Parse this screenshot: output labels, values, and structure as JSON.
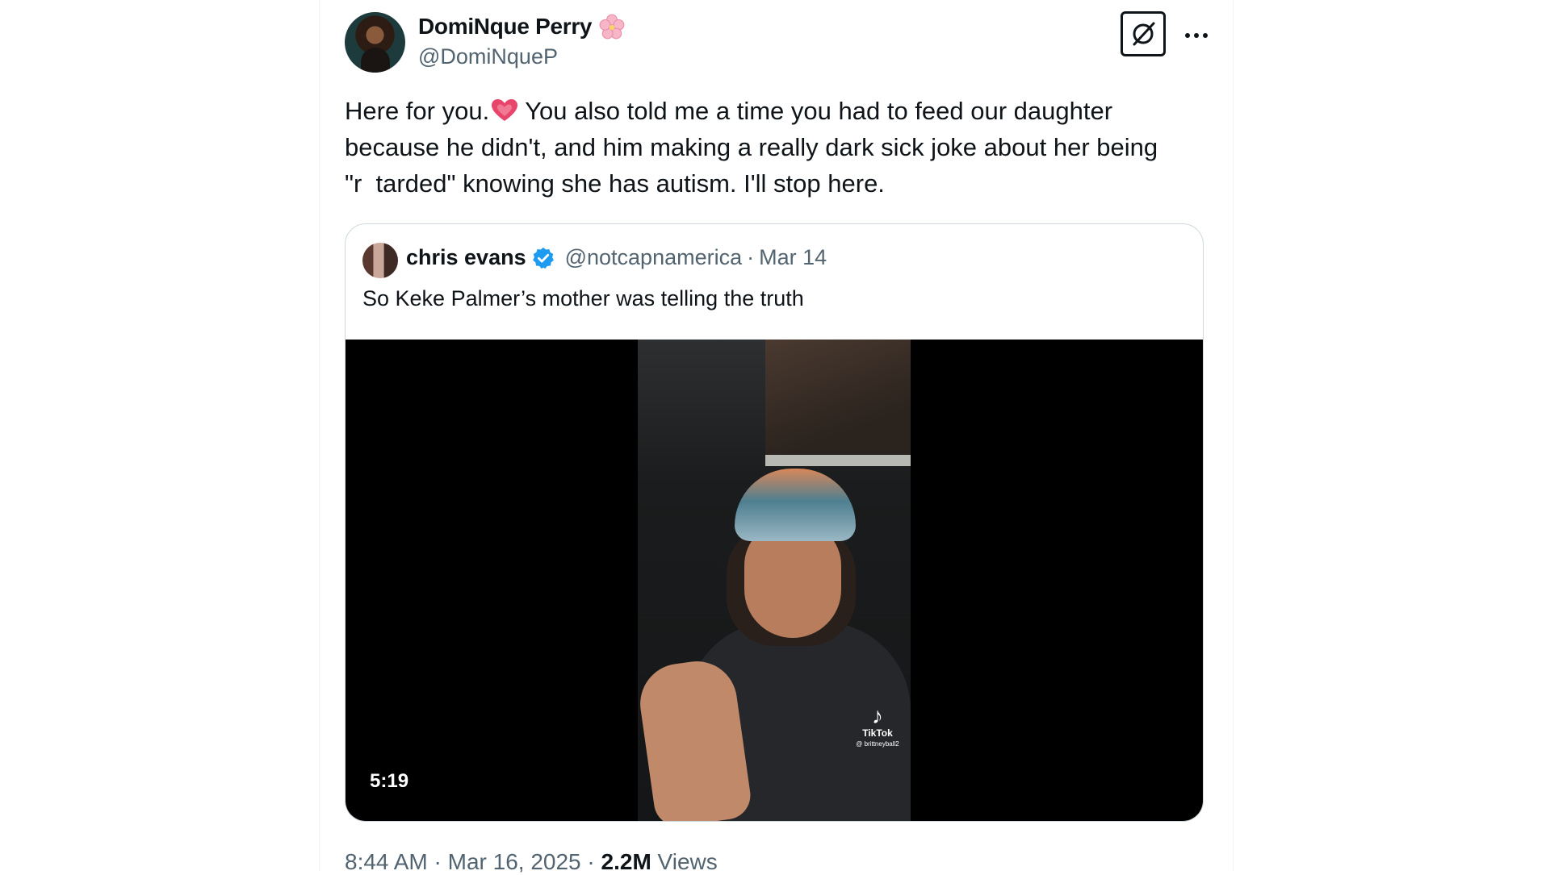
{
  "tweet": {
    "author_name": "DomiNque Perry",
    "author_handle": "@DomiNqueP",
    "text_line_1_pre": "Here for you.",
    "text_line_1_post": "You also told me a time you had to feed our daughter",
    "text_line_2": "because he didn't, and him making a really dark sick joke about her being",
    "text_line_3": "\"r  tarded\" knowing she has autism. I'll stop here.",
    "time": "8:44 AM",
    "date": "Mar 16, 2025",
    "separator": "·",
    "views_count": "2.2M",
    "views_label": "Views"
  },
  "quote": {
    "author_name": "chris evans",
    "author_handle": "@notcapnamerica",
    "separator": "·",
    "date": "Mar 14",
    "text": "So Keke Palmer’s mother was telling the truth",
    "video_duration": "5:19",
    "watermark_brand": "TikTok",
    "watermark_user": "@ brittneyball2"
  },
  "icons": {
    "grok": "grok-slash-icon",
    "more": "more-horizontal-icon",
    "verified": "verified-badge-icon",
    "flower": "cherry-blossom-emoji",
    "heart": "growing-heart-emoji"
  },
  "colors": {
    "text_primary": "#0f1419",
    "text_secondary": "#536471",
    "verified_blue": "#1d9bf0",
    "border": "#cfd9de",
    "heart_pink": "#e8456b"
  }
}
